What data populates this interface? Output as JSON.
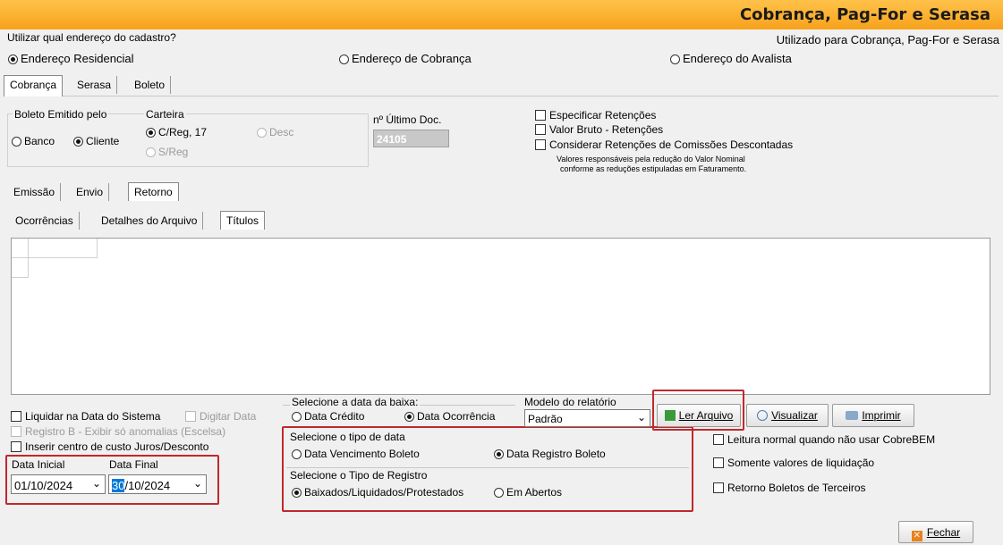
{
  "window": {
    "title": "Cobrança, Pag-For e Serasa"
  },
  "address": {
    "question": "Utilizar qual endereço do cadastro?",
    "hint": "Utilizado para Cobrança, Pag-For e Serasa",
    "options": [
      "Endereço Residencial",
      "Endereço de Cobrança",
      "Endereço do Avalista"
    ],
    "selected": "Endereço Residencial"
  },
  "main_tabs": [
    "Cobrança",
    "Serasa",
    "Boleto"
  ],
  "boleto_emitido": {
    "label": "Boleto Emitido pelo",
    "banco": "Banco",
    "cliente": "Cliente",
    "selected": "Cliente"
  },
  "carteira": {
    "label": "Carteira",
    "creg": "C/Reg, 17",
    "desc": "Desc",
    "sreg": "S/Reg",
    "selected": "C/Reg, 17"
  },
  "ultimo_doc": {
    "label": "nº Último Doc.",
    "value": "24105"
  },
  "retencoes": {
    "especificar": "Especificar Retenções",
    "valor_bruto": "Valor Bruto - Retenções",
    "considerar": "Considerar Retenções de Comissões Descontadas",
    "note_line1": "Valores responsáveis pela redução do Valor Nominal",
    "note_line2": "conforme as reduções estipuladas em Faturamento."
  },
  "sub_tabs": [
    "Emissão",
    "Envio",
    "Retorno"
  ],
  "retorno_tabs": [
    "Ocorrências",
    "Detalhes do Arquivo",
    "Títulos"
  ],
  "options_left": {
    "liquidar": "Liquidar na Data do Sistema",
    "digitar": "Digitar Data",
    "registro_b": "Registro B - Exibir só anomalias (Escelsa)",
    "inserir": "Inserir centro de custo Juros/Desconto"
  },
  "dates": {
    "inicial_label": "Data Inicial",
    "final_label": "Data Final",
    "inicial_value": "01/10/2024",
    "final_day": "30",
    "final_rest": "/10/2024"
  },
  "data_baixa": {
    "label": "Selecione a data da baixa:",
    "credito": "Data Crédito",
    "ocorrencia": "Data Ocorrência",
    "selected": "Data Ocorrência"
  },
  "tipo_data": {
    "label": "Selecione o tipo de data",
    "vencimento": "Data Vencimento Boleto",
    "registro": "Data Registro Boleto",
    "selected": "Data Registro Boleto"
  },
  "tipo_registro": {
    "label": "Selecione o Tipo de Registro",
    "baixados": "Baixados/Liquidados/Protestados",
    "abertos": "Em Abertos",
    "selected": "Baixados/Liquidados/Protestados"
  },
  "modelo": {
    "label": "Modelo do relatório",
    "value": "Padrão"
  },
  "buttons": {
    "ler_arquivo": "Ler Arquivo",
    "visualizar": "Visualizar",
    "imprimir": "Imprimir",
    "fechar": "Fechar"
  },
  "options_right": {
    "leitura": "Leitura normal quando não usar CobreBEM",
    "somente": "Somente valores de liquidação",
    "terceiros": "Retorno Boletos de Terceiros"
  }
}
